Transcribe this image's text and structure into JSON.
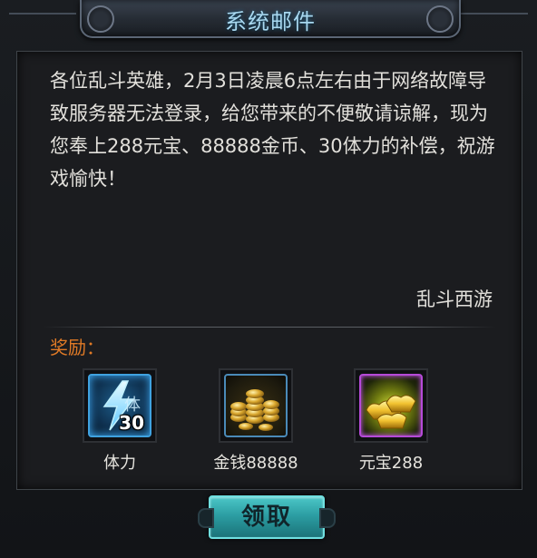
{
  "dialog": {
    "title": "系统邮件"
  },
  "mail": {
    "body": "各位乱斗英雄，2月3日凌晨6点左右由于网络故障导致服务器无法登录，给您带来的不便敬请谅解，现为您奉上288元宝、88888金币、30体力的补偿，祝游戏愉快！",
    "signature": "乱斗西游"
  },
  "rewards": {
    "label": "奖励：",
    "items": [
      {
        "name": "体力",
        "icon": "stamina-lightning-icon",
        "quantity": "30",
        "icon_glyph": "体"
      },
      {
        "name": "金钱88888",
        "icon": "gold-coins-icon"
      },
      {
        "name": "元宝288",
        "icon": "gold-ingot-icon"
      }
    ]
  },
  "actions": {
    "claim_label": "领取"
  },
  "colors": {
    "title": "#a8d8f0",
    "reward_label": "#e07a26",
    "button": "#2c9ea3"
  }
}
